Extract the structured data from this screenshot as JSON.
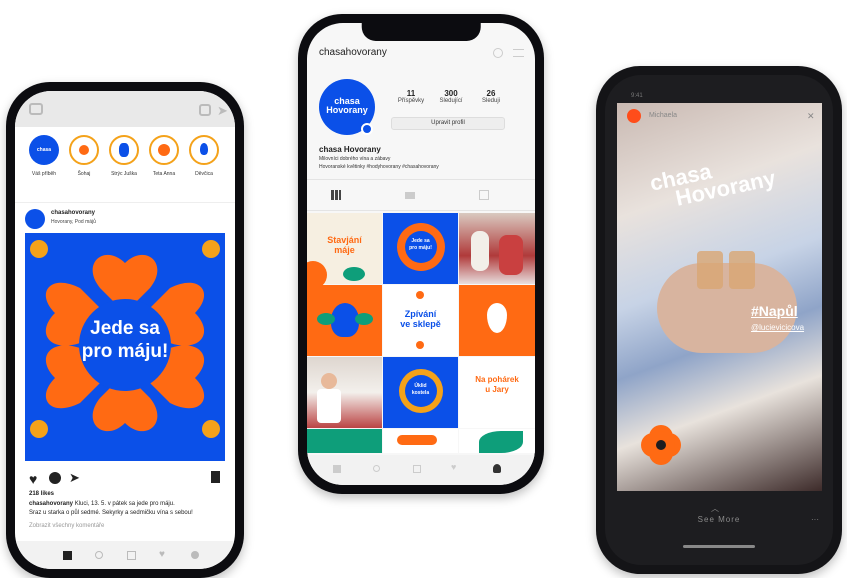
{
  "colors": {
    "blue": "#0b50e8",
    "orange": "#ff6a13",
    "green": "#0e9e7a",
    "yellow": "#f4a21a",
    "pink": "#f36a8a"
  },
  "feed": {
    "stories": [
      {
        "label": "Váš příběh",
        "icon": "logo-icon"
      },
      {
        "label": "Šohaj",
        "icon": "flower-icon"
      },
      {
        "label": "Strýc Juška",
        "icon": "grape-icon"
      },
      {
        "label": "Teta Anna",
        "icon": "flower-icon"
      },
      {
        "label": "Děvčica",
        "icon": "tulip-icon"
      }
    ],
    "post_user": "chasahovorany",
    "post_location": "Hovorany, Pod májů",
    "post_headline_1": "Jede sa",
    "post_headline_2": "pro máju!",
    "likes": "218 likes",
    "caption_user": "chasahovorany",
    "caption_text": "Kluci, 13. 5. v pátek sa jede pro máju.",
    "caption_text_2": "Sraz u starka o půl sedmé. Sekyrky a sedmičku vína s sebou!",
    "comments_link": "Zobrazit všechny komentáře",
    "logo_line1": "chasa",
    "logo_line2": "Hovorany"
  },
  "profile": {
    "username": "chasahovorany",
    "avatar_line1": "chasa",
    "avatar_line2": "Hovorany",
    "posts_count": "11",
    "posts_label": "Příspěvky",
    "followers_count": "300",
    "followers_label": "Sledující",
    "following_count": "26",
    "following_label": "Sleduji",
    "edit_button": "Upravit profil",
    "name": "chasa Hovorany",
    "bio_1": "Milovníci dobrého vína a zábavy",
    "bio_2": "Hovoranské květinky #hodyhovorany #chasahovorany",
    "grid": {
      "t1a": "Stavjání",
      "t1b": "máje",
      "t2a": "Jede sa",
      "t2b": "pro máju!",
      "t4a": "Zpívání",
      "t4b": "ve sklepě",
      "t7a": "Úklid",
      "t7b": "kostela",
      "t8a": "Na pohárek",
      "t8b": "u Jary"
    }
  },
  "story": {
    "time": "9:41",
    "user": "Michaela",
    "brand_1": "chasa",
    "brand_2": "Hovorany",
    "hashtag": "#Napůl",
    "mention": "@lucievicicova",
    "see_more": "See More"
  }
}
